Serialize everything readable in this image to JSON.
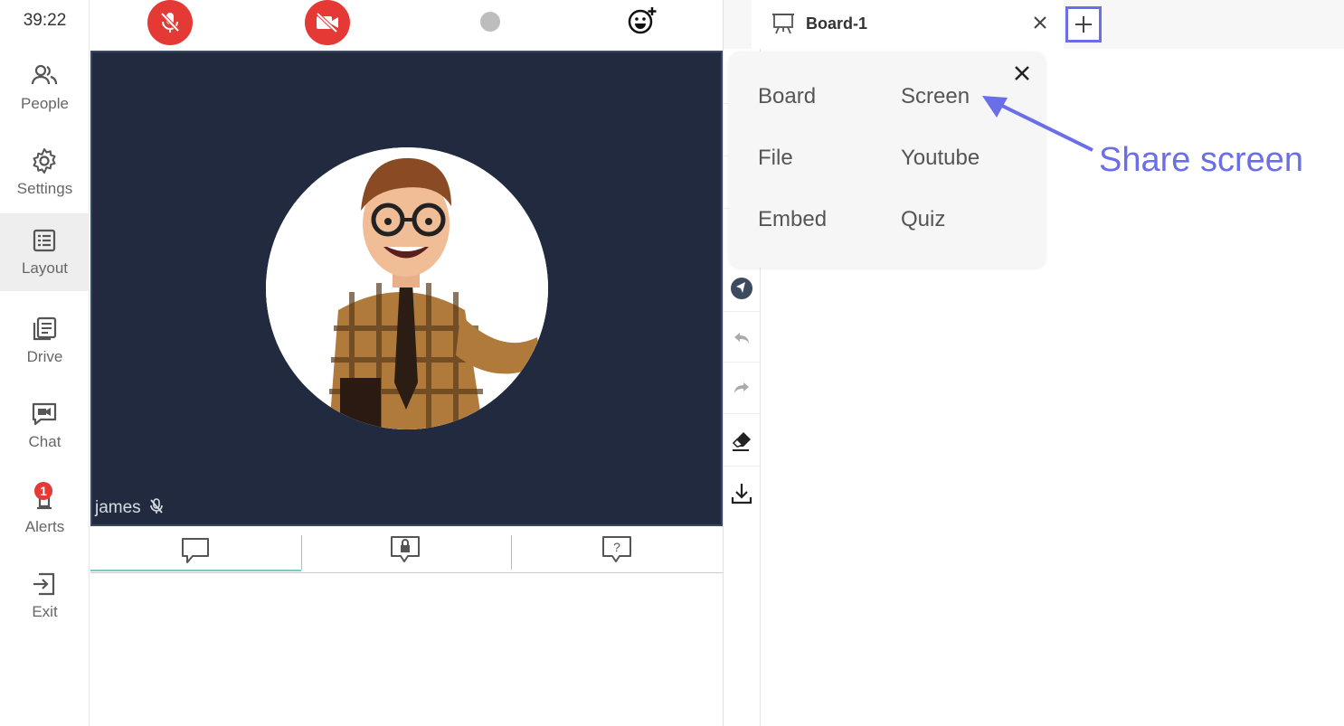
{
  "sidebar": {
    "timer": "39:22",
    "items": [
      {
        "label": "People",
        "icon": "people-icon"
      },
      {
        "label": "Settings",
        "icon": "gear-icon"
      },
      {
        "label": "Layout",
        "icon": "layout-icon"
      },
      {
        "label": "Drive",
        "icon": "drive-icon"
      },
      {
        "label": "Chat",
        "icon": "chat-video-icon"
      },
      {
        "label": "Alerts",
        "icon": "bell-icon",
        "badge": "1"
      },
      {
        "label": "Exit",
        "icon": "exit-icon"
      }
    ]
  },
  "video": {
    "participant_name": "james"
  },
  "board": {
    "tab_label": "Board-1"
  },
  "share_menu": {
    "items": [
      "Board",
      "Screen",
      "File",
      "Youtube",
      "Embed",
      "Quiz"
    ]
  },
  "annotation": {
    "text": "Share screen"
  },
  "colors": {
    "accent": "#6a6ee8",
    "danger": "#e53935",
    "video_bg": "#212a3e",
    "active_tab_underline": "#7fc8c8"
  }
}
